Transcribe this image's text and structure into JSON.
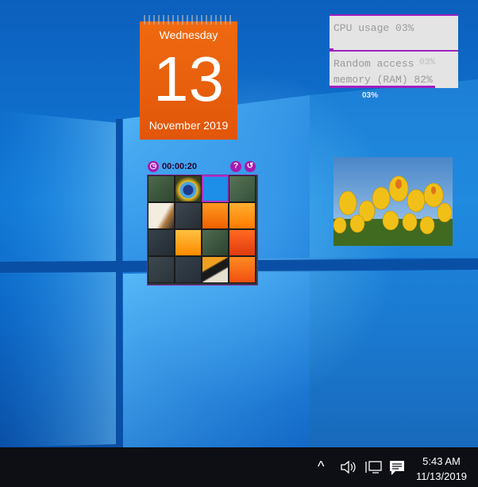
{
  "calendar": {
    "weekday": "Wednesday",
    "day": "13",
    "month_year": "November 2019"
  },
  "meters": {
    "cpu_label": "CPU usage 03%",
    "ram_label_line1": "Random access",
    "ram_label_line2": "memory (RAM) 82%",
    "ram_overlay": "03%",
    "cpu_percent_below": "03%",
    "cpu_level": 0.03,
    "ram_level": 0.82
  },
  "puzzle": {
    "timer": "00:00:20",
    "help_label": "?",
    "reset_label": "↺"
  },
  "taskbar": {
    "time": "5:43 AM",
    "date": "11/13/2019"
  },
  "icons": [
    "chevron-up-icon",
    "volume-icon",
    "network-icon",
    "notification-icon"
  ]
}
